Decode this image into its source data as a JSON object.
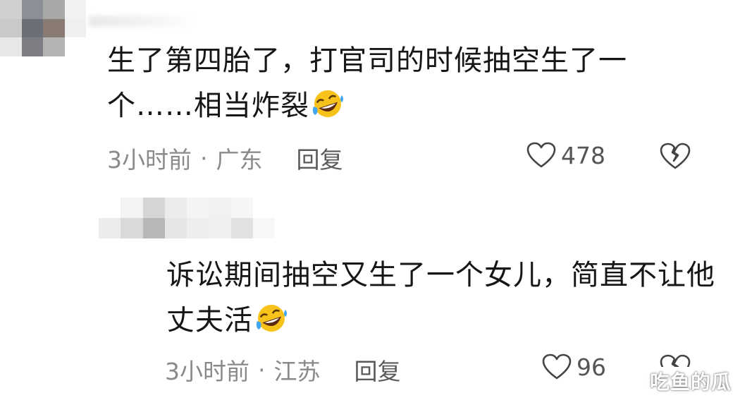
{
  "comments": [
    {
      "text": "生了第四胎了，打官司的时候抽空生了一个……相当炸裂",
      "time": "3小时前",
      "location": "广东",
      "reply_label": "回复",
      "likes": "478",
      "emoji_icon": "rofl-emoji-icon"
    },
    {
      "text": "诉讼期间抽空又生了一个女儿，简直不让他丈夫活",
      "time": "3小时前",
      "location": "江苏",
      "reply_label": "回复",
      "likes": "96",
      "emoji_icon": "rofl-emoji-icon"
    }
  ],
  "separator": "·",
  "watermark": "吃鱼的瓜",
  "colors": {
    "text": "#161616",
    "meta": "#8a8a8a",
    "emoji_face": "#f7c21b"
  }
}
